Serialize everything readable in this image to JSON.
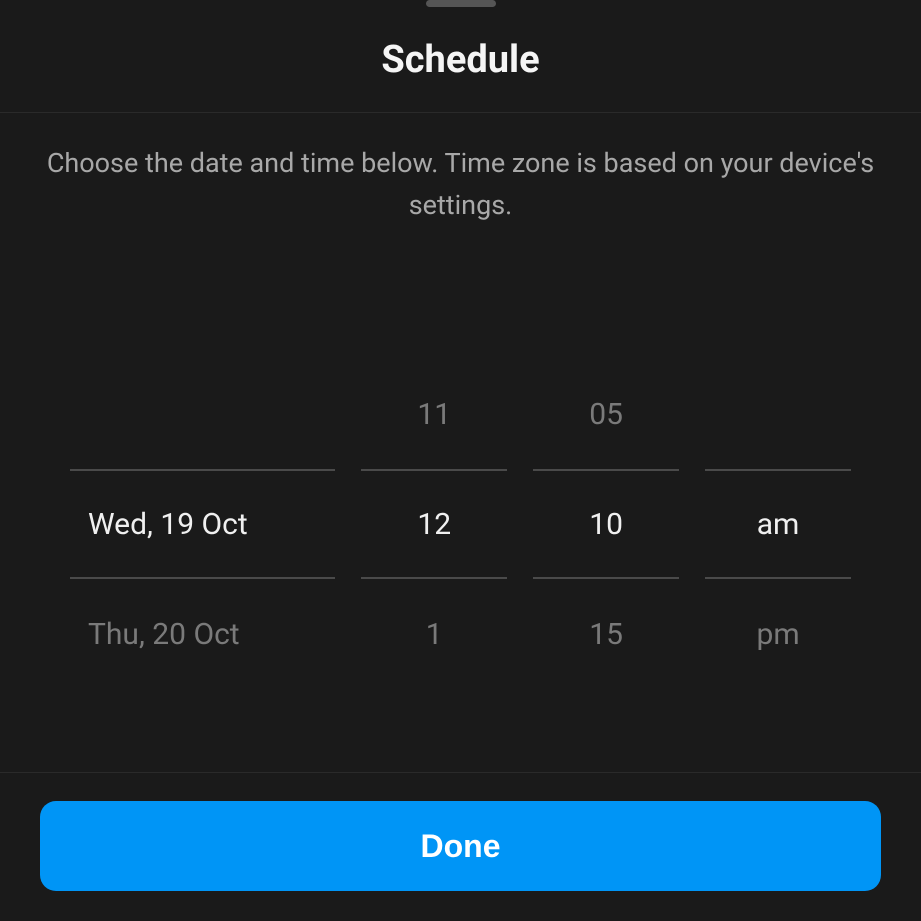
{
  "header": {
    "title": "Schedule"
  },
  "subtitle": "Choose the date and time below. Time zone is based on your device's settings.",
  "picker": {
    "date": {
      "prev": "",
      "selected": "Wed, 19 Oct",
      "next": "Thu, 20 Oct"
    },
    "hour": {
      "prev": "11",
      "selected": "12",
      "next": "1"
    },
    "minute": {
      "prev": "05",
      "selected": "10",
      "next": "15"
    },
    "ampm": {
      "prev": "",
      "selected": "am",
      "next": "pm"
    }
  },
  "footer": {
    "done_label": "Done"
  },
  "colors": {
    "accent": "#0095f6",
    "bg": "#1a1a1a",
    "text": "#f0f0f0",
    "muted": "#7a7a7a",
    "divider": "#4a4a4a"
  }
}
